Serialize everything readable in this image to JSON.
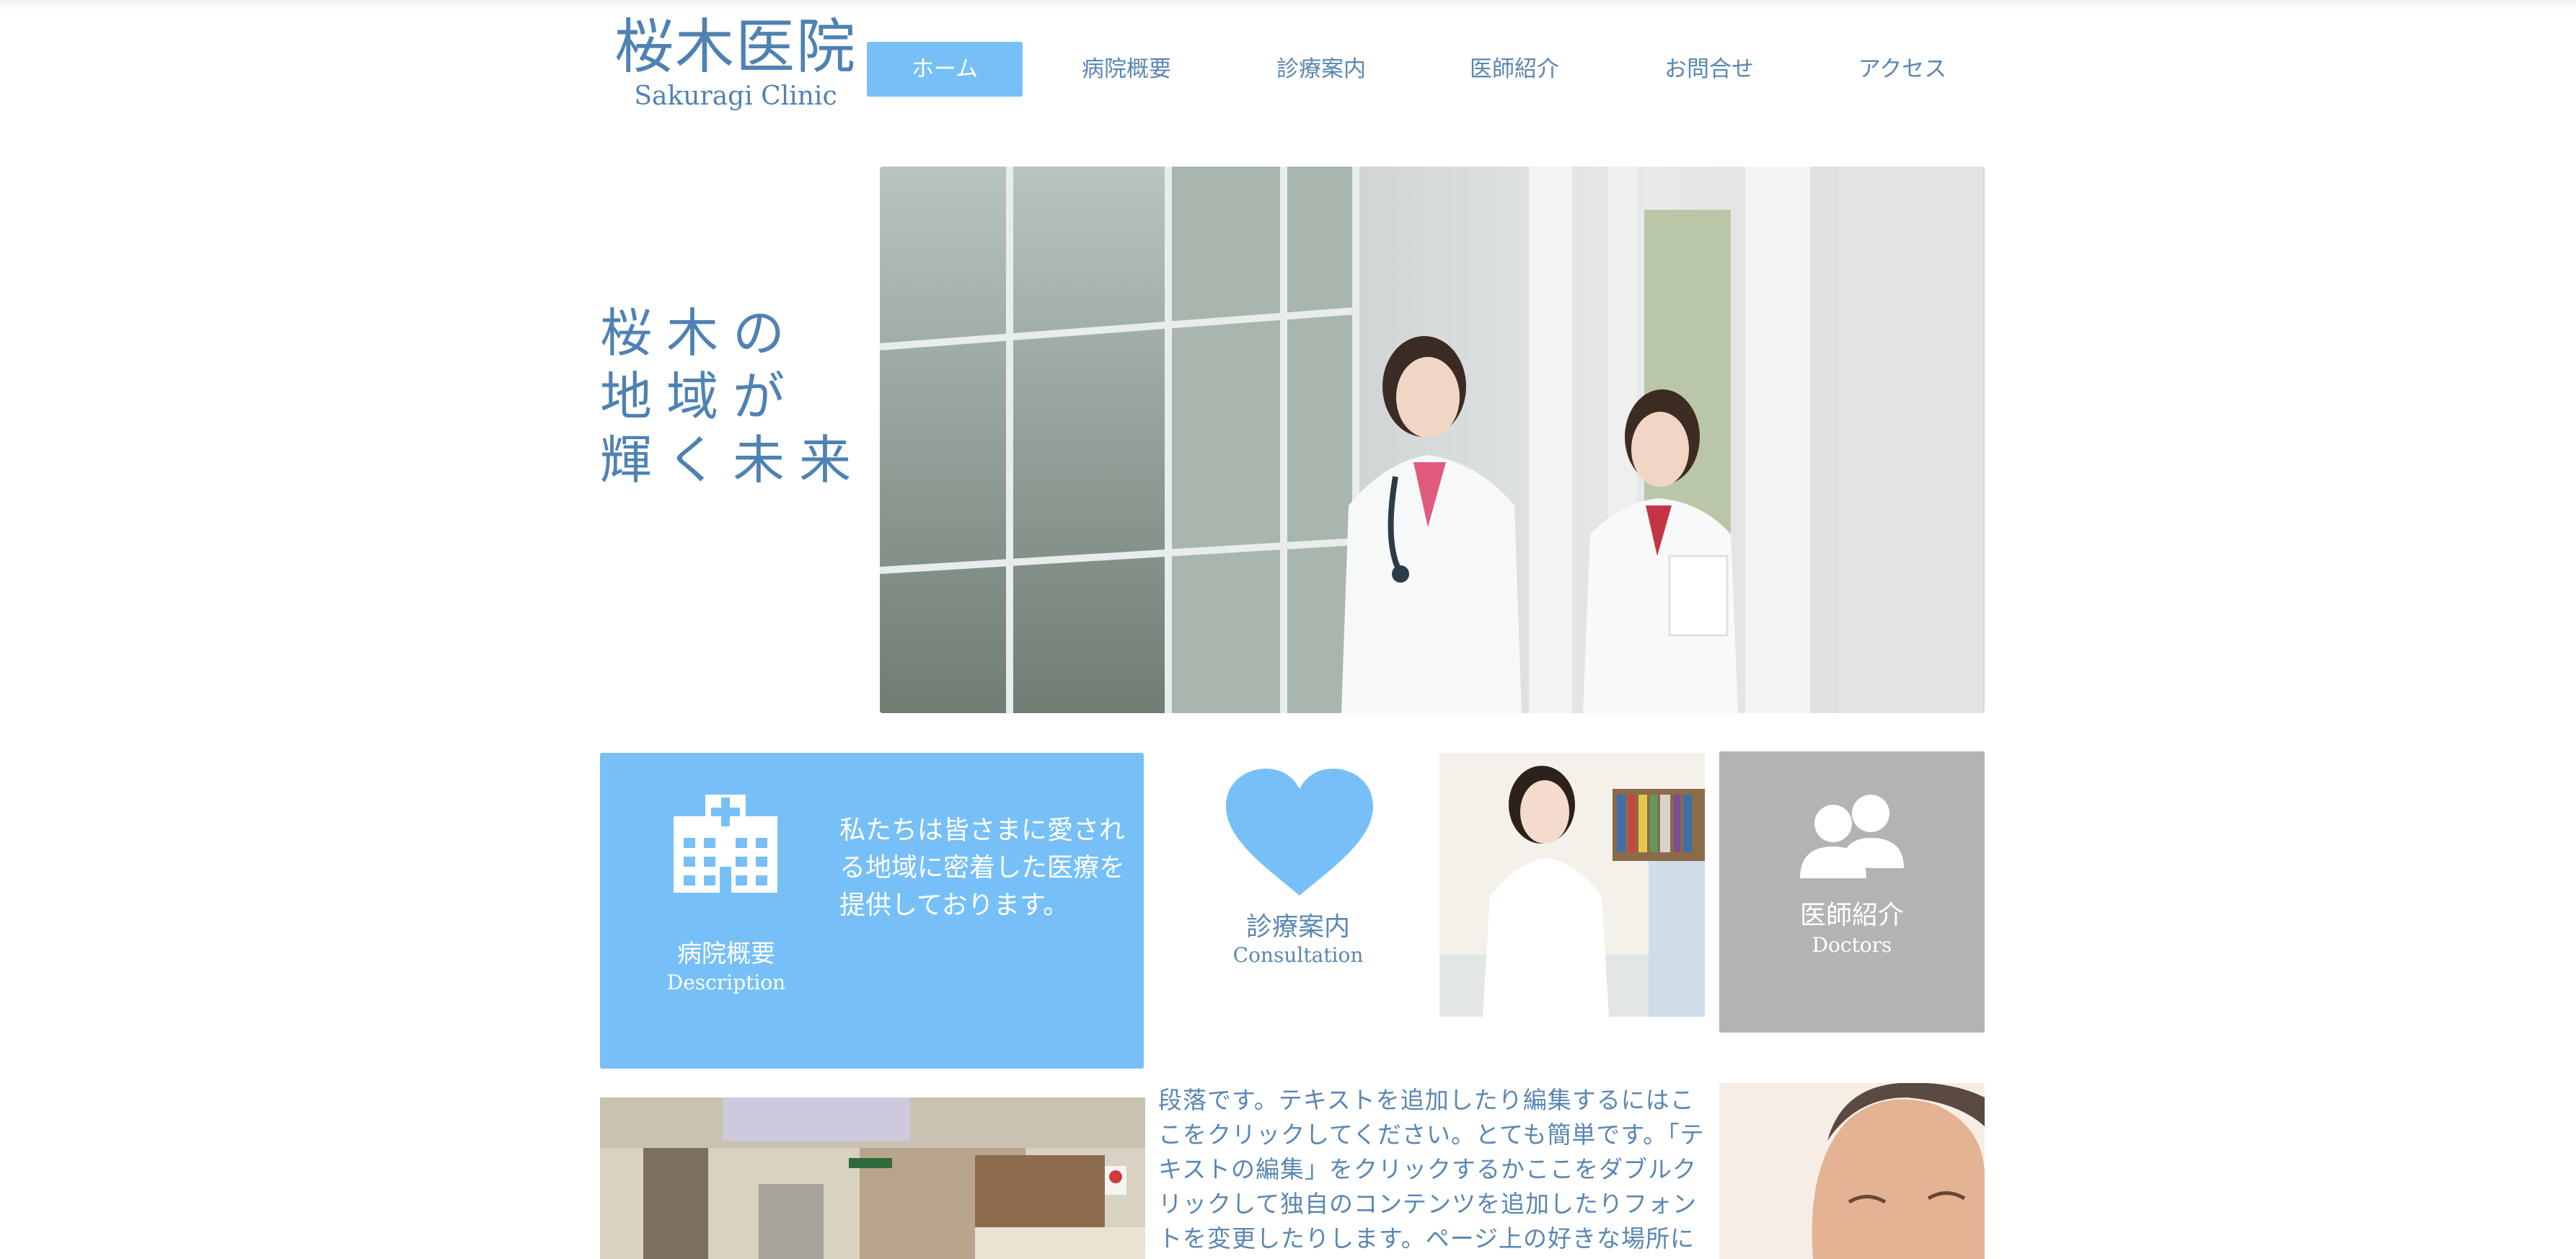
{
  "header": {
    "logo_title": "桜木医院",
    "logo_subtitle": "Sakuragi Clinic",
    "nav": [
      {
        "label": "ホーム",
        "active": true
      },
      {
        "label": "病院概要",
        "active": false
      },
      {
        "label": "診療案内",
        "active": false
      },
      {
        "label": "医師紹介",
        "active": false
      },
      {
        "label": "お問合せ",
        "active": false
      },
      {
        "label": "アクセス",
        "active": false
      }
    ]
  },
  "hero": {
    "lines": [
      "桜木の",
      "地域が",
      "輝く未来"
    ]
  },
  "tiles": {
    "description": {
      "label": "病院概要",
      "sublabel": "Description",
      "text": "私たちは皆さまに愛される地域に密着した医療を提供しております。",
      "icon": "hospital-icon"
    },
    "consultation": {
      "label": "診療案内",
      "sublabel": "Consultation",
      "icon": "heart-icon"
    },
    "doctors": {
      "label": "医師紹介",
      "sublabel": "Doctors",
      "icon": "people-icon"
    }
  },
  "paragraph": {
    "text": "段落です。テキストを追加したり編集するにはここをクリックしてください。とても簡単です。「テキストの編集」をクリックするかここをダブルクリックして独自のコンテンツを追加したりフォントを変更したりします。ページ上の好きな場所にドラッグ&"
  },
  "colors": {
    "accent": "#76c0f7",
    "text_blue": "#5a87b3",
    "logo_blue": "#4f82b3",
    "tile_gray": "#b3b3b3"
  }
}
